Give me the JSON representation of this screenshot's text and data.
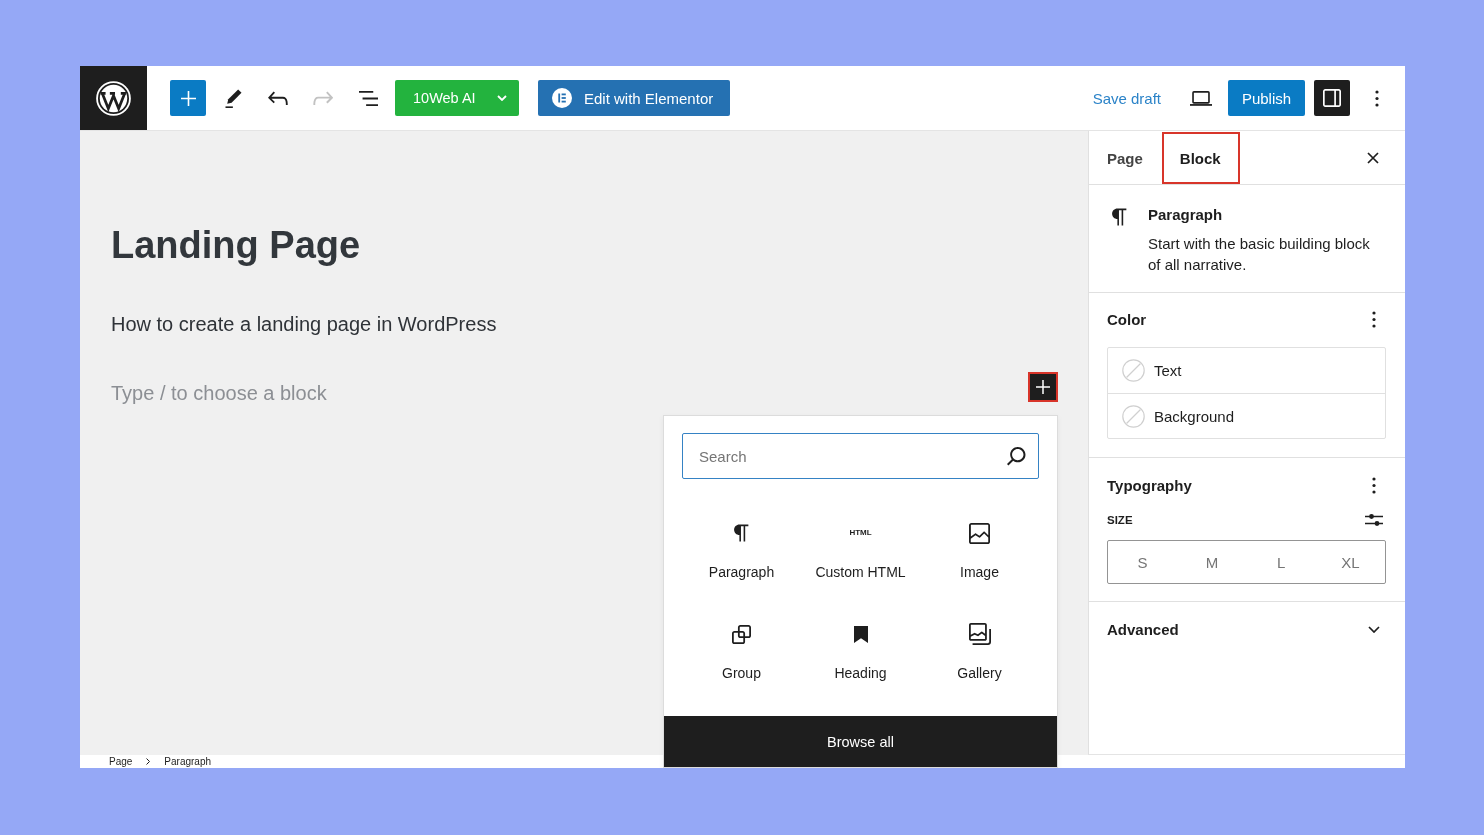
{
  "top_bar": {
    "tools": [
      {
        "kind": "inserter",
        "disabled": false
      },
      {
        "kind": "tools",
        "disabled": false
      },
      {
        "kind": "undo",
        "disabled": false
      },
      {
        "kind": "redo",
        "disabled": true
      },
      {
        "kind": "list_view",
        "disabled": false
      }
    ],
    "ai_button": {
      "label": "10Web AI"
    },
    "elementor_button": {
      "label": "Edit with Elementor"
    },
    "save_draft": "Save draft",
    "publish": "Publish",
    "settings_toggle": {
      "pressed": true
    }
  },
  "editor": {
    "title": "Landing Page",
    "paragraph": "How to create a landing page in WordPress",
    "placeholder": "Type / to choose a block",
    "inserter_button": {
      "highlighted": true
    }
  },
  "inserter_popover": {
    "search": {
      "placeholder": "Search"
    },
    "blocks": [
      {
        "kind": "paragraph",
        "label": "Paragraph"
      },
      {
        "kind": "html",
        "label": "Custom HTML",
        "icon_text": "HTML"
      },
      {
        "kind": "image",
        "label": "Image"
      },
      {
        "kind": "group",
        "label": "Group"
      },
      {
        "kind": "heading",
        "label": "Heading"
      },
      {
        "kind": "gallery",
        "label": "Gallery"
      }
    ],
    "browse_all": "Browse all"
  },
  "sidebar": {
    "tabs": [
      {
        "label": "Page",
        "selected": false,
        "highlighted": false
      },
      {
        "label": "Block",
        "selected": true,
        "highlighted": true
      }
    ],
    "block_card": {
      "title": "Paragraph",
      "description": "Start with the basic building block of all narrative."
    },
    "panels": [
      {
        "kind": "color",
        "title": "Color",
        "items": [
          {
            "label": "Text"
          },
          {
            "label": "Background"
          }
        ]
      },
      {
        "kind": "typography",
        "title": "Typography",
        "size_label": "SIZE",
        "sizes": [
          {
            "label": "S",
            "selected": false
          },
          {
            "label": "M",
            "selected": false
          },
          {
            "label": "L",
            "selected": false
          },
          {
            "label": "XL",
            "selected": false
          }
        ]
      },
      {
        "kind": "advanced",
        "title": "Advanced",
        "expanded": false
      }
    ]
  },
  "breadcrumb": [
    "Page",
    "Paragraph"
  ]
}
